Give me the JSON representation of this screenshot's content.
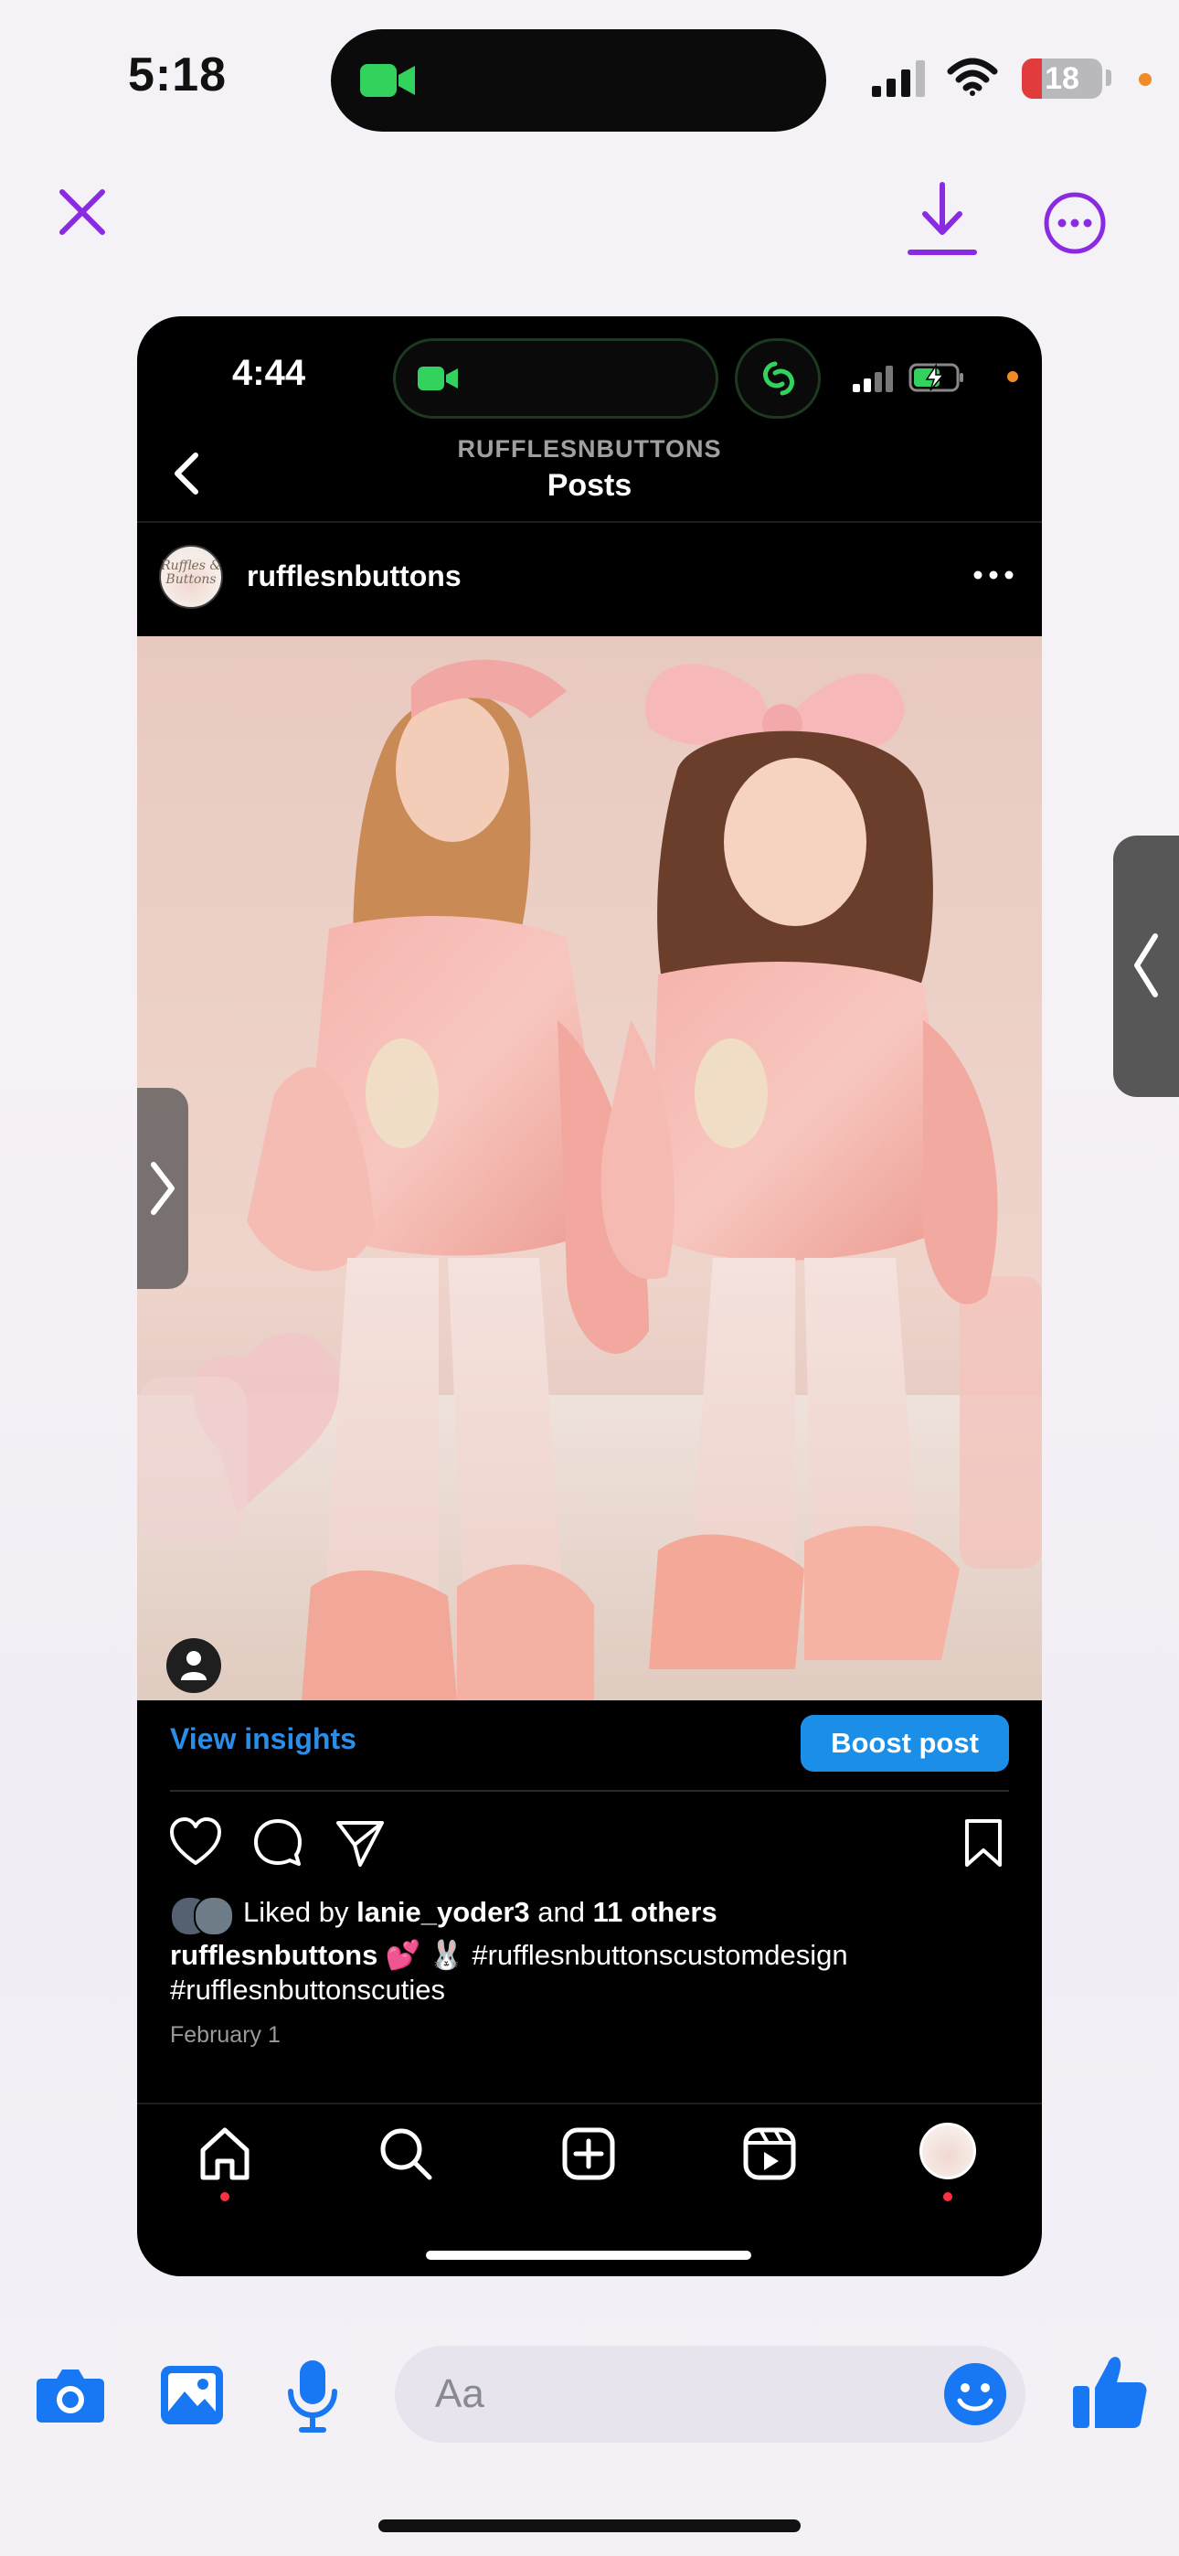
{
  "status_bar": {
    "time": "5:18",
    "battery": "18"
  },
  "viewer": {
    "close_icon": "close-icon",
    "download_icon": "download-icon",
    "more_icon": "more-options-icon",
    "accent": "#8a2be2"
  },
  "screenshot": {
    "status": {
      "time": "4:44"
    },
    "header": {
      "account": "RUFFLESNBUTTONS",
      "title": "Posts"
    },
    "post": {
      "username": "rufflesnbuttons",
      "avatar_text": "Ruffles & Buttons",
      "view_insights": "View insights",
      "boost_post": "Boost post",
      "likes_prefix": "Liked by ",
      "likes_user": "lanie_yoder3",
      "likes_mid": " and ",
      "likes_others": "11 others",
      "caption_user": "rufflesnbuttons",
      "caption_text": " 💕 🐰 #rufflesnbuttonscustomdesign #rufflesnbuttonscuties",
      "date": "February 1"
    },
    "accent_blue": "#1b8fe8"
  },
  "composer": {
    "placeholder": "Aa",
    "accent": "#1877f2"
  }
}
